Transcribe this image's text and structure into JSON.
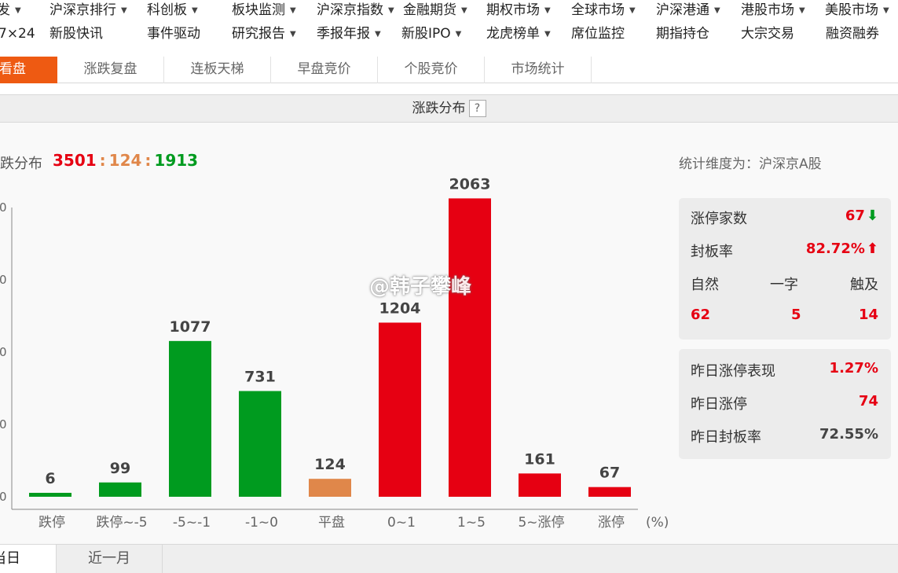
{
  "nav": {
    "row1": [
      {
        "label": "发",
        "caret": true
      },
      {
        "label": "沪深京排行",
        "caret": true
      },
      {
        "label": "科创板",
        "caret": true
      },
      {
        "label": "板块监测",
        "caret": true
      },
      {
        "label": "沪深京指数",
        "caret": true
      },
      {
        "label": "金融期货",
        "caret": true
      },
      {
        "label": "期权市场",
        "caret": true
      },
      {
        "label": "全球市场",
        "caret": true
      },
      {
        "label": "沪深港通",
        "caret": true
      },
      {
        "label": "港股市场",
        "caret": true
      },
      {
        "label": "美股市场",
        "caret": true
      }
    ],
    "row2": [
      {
        "label": "7×24",
        "caret": false
      },
      {
        "label": "新股快讯",
        "caret": false
      },
      {
        "label": "事件驱动",
        "caret": false
      },
      {
        "label": "研究报告",
        "caret": true
      },
      {
        "label": "季报年报",
        "caret": true
      },
      {
        "label": "新股IPO",
        "caret": true
      },
      {
        "label": "龙虎榜单",
        "caret": true
      },
      {
        "label": "席位监控",
        "caret": false
      },
      {
        "label": "期指持仓",
        "caret": false
      },
      {
        "label": "大宗交易",
        "caret": false
      },
      {
        "label": "融资融券",
        "caret": false
      }
    ]
  },
  "tabs": [
    "盘看盘",
    "涨跌复盘",
    "连板天梯",
    "早盘竞价",
    "个股竞价",
    "市场统计"
  ],
  "section": {
    "title": "涨跌分布",
    "help": "?"
  },
  "summary": {
    "label": "跌分布",
    "up": "3501",
    "flat": "124",
    "down": "1913",
    "dimension": "统计维度为：沪深京A股"
  },
  "colors": {
    "up": "#e60012",
    "down": "#009b1f",
    "flat": "#e0874a",
    "accent": "#ee5a12"
  },
  "chart_data": {
    "type": "bar",
    "categories": [
      "跌停",
      "跌停~-5",
      "-5~-1",
      "-1~0",
      "平盘",
      "0~1",
      "1~5",
      "5~涨停",
      "涨停"
    ],
    "values": [
      6,
      99,
      1077,
      731,
      124,
      1204,
      2063,
      161,
      67
    ],
    "value_labels": [
      "6",
      "99",
      "1077",
      "731",
      "124",
      "1204",
      "2063",
      "161",
      "67"
    ],
    "bar_colors": [
      "#009b1f",
      "#009b1f",
      "#009b1f",
      "#009b1f",
      "#e0874a",
      "#e60012",
      "#e60012",
      "#e60012",
      "#e60012"
    ],
    "y_ticks": [
      0,
      500,
      1000,
      1500,
      2000
    ],
    "y_tick_labels": [
      "0",
      "0",
      "0",
      "0",
      "0"
    ],
    "ylim": [
      0,
      2000
    ],
    "x_unit": "(%)",
    "grid": false
  },
  "panel1": {
    "limit_up_label": "涨停家数",
    "limit_up_value": "67",
    "seal_rate_label": "封板率",
    "seal_rate_value": "82.72%",
    "headers": [
      "自然",
      "一字",
      "触及"
    ],
    "values": [
      "62",
      "5",
      "14"
    ],
    "limit_up_trend": "arrow-down-icon",
    "seal_rate_trend": "arrow-up-icon"
  },
  "panel2": {
    "rows": [
      {
        "label": "昨日涨停表现",
        "value": "1.27%"
      },
      {
        "label": "昨日涨停",
        "value": "74"
      },
      {
        "label": "昨日封板率",
        "value": "72.55%"
      }
    ]
  },
  "bottom_tabs": [
    "当日",
    "近一月"
  ],
  "watermark": "@韩子攀峰"
}
